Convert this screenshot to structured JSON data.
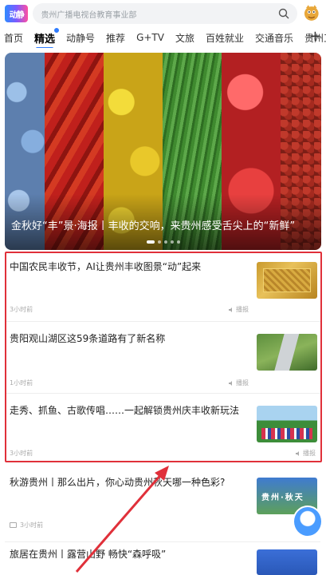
{
  "app": {
    "logo_text": "动静",
    "search_placeholder": "贵州广播电视台教育事业部"
  },
  "tabs": [
    {
      "label": "首页"
    },
    {
      "label": "精选",
      "active": true
    },
    {
      "label": "动静号"
    },
    {
      "label": "推荐"
    },
    {
      "label": "G+TV"
    },
    {
      "label": "文旅"
    },
    {
      "label": "百姓就业"
    },
    {
      "label": "交通音乐"
    },
    {
      "label": "贵州工"
    }
  ],
  "plus_label": "+",
  "banner": {
    "title": "金秋好“丰”景·海报丨丰收的交响，来贵州感受舌尖上的“新鲜”",
    "page_count": 5,
    "current_page": 1
  },
  "articles": [
    {
      "title": "中国农民丰收节，AI让贵州丰收图景“动”起来",
      "meta": "3小时前",
      "share": "播报",
      "thumb": "golden-plate"
    },
    {
      "title": "贵阳观山湖区这59条道路有了新名称",
      "meta": "1小时前",
      "share": "播报",
      "thumb": "aerial-roads"
    },
    {
      "title": "走秀、抓鱼、古歌传唱……一起解锁贵州庆丰收新玩法",
      "meta": "3小时前",
      "share": "播报",
      "thumb": "festival-crowd"
    },
    {
      "title": "秋游贵州丨那么出片，你心动贵州秋天哪一种色彩?",
      "meta": "3小时前",
      "thumb": "autumn-guizhou",
      "thumb_label": "贵州·秋天"
    },
    {
      "title": "旅居在贵州丨露营山野 畅快“森呼吸”",
      "thumb": "camping"
    }
  ],
  "colors": {
    "accent": "#2f7cff",
    "highlight": "#e0303a"
  }
}
